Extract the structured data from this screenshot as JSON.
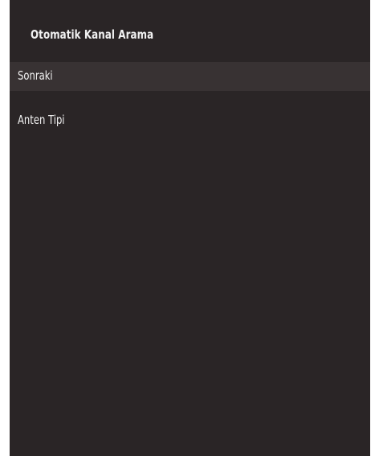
{
  "panel": {
    "title": "Otomatik Kanal Arama",
    "background_color": "#2a2526",
    "selected_row_color": "#383233"
  },
  "menu": {
    "items": [
      {
        "label": "Sonraki",
        "selected": true
      },
      {
        "label": "Anten Tipi",
        "selected": false
      }
    ]
  }
}
